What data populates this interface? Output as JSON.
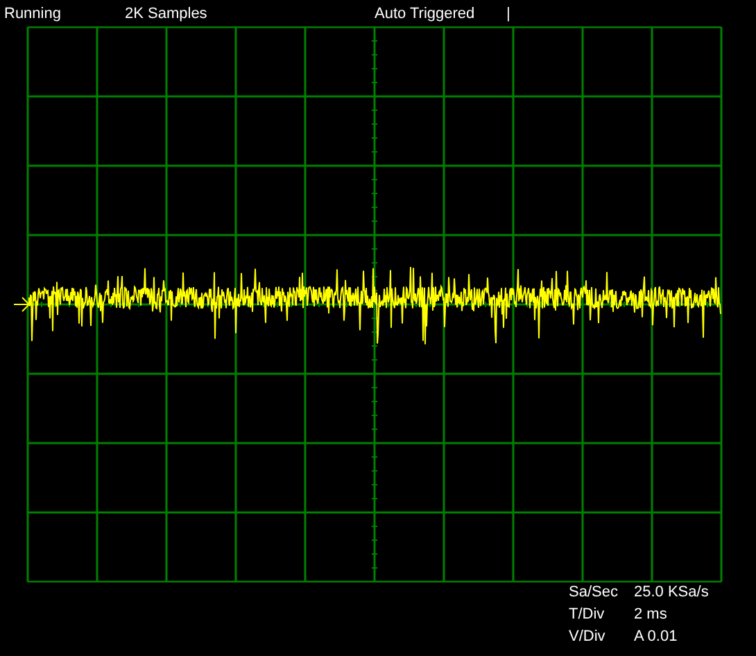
{
  "status_bar": {
    "state": "Running",
    "samples": "2K Samples",
    "trigger": "Auto Triggered",
    "marker": "|"
  },
  "readings": [
    {
      "label": "Sa/Sec",
      "value": "25.0 KSa/s"
    },
    {
      "label": "T/Div",
      "value": "2 ms"
    },
    {
      "label": "V/Div",
      "value": "A 0.01"
    }
  ]
}
